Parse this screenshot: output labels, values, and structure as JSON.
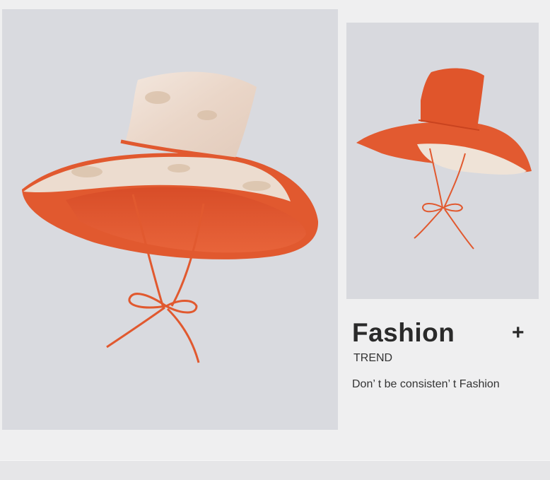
{
  "caption": {
    "title": "Fashion",
    "plus": "+",
    "subtitle": "TREND",
    "tagline": "Don’ t be consisten’ t Fashion"
  },
  "images": {
    "left": "hat-floral-side-view",
    "right": "hat-orange-side-view"
  },
  "colors": {
    "background": "#efeff0",
    "orange": "#e1592f",
    "floral": "#ecdccf",
    "text": "#2a2a2a"
  }
}
